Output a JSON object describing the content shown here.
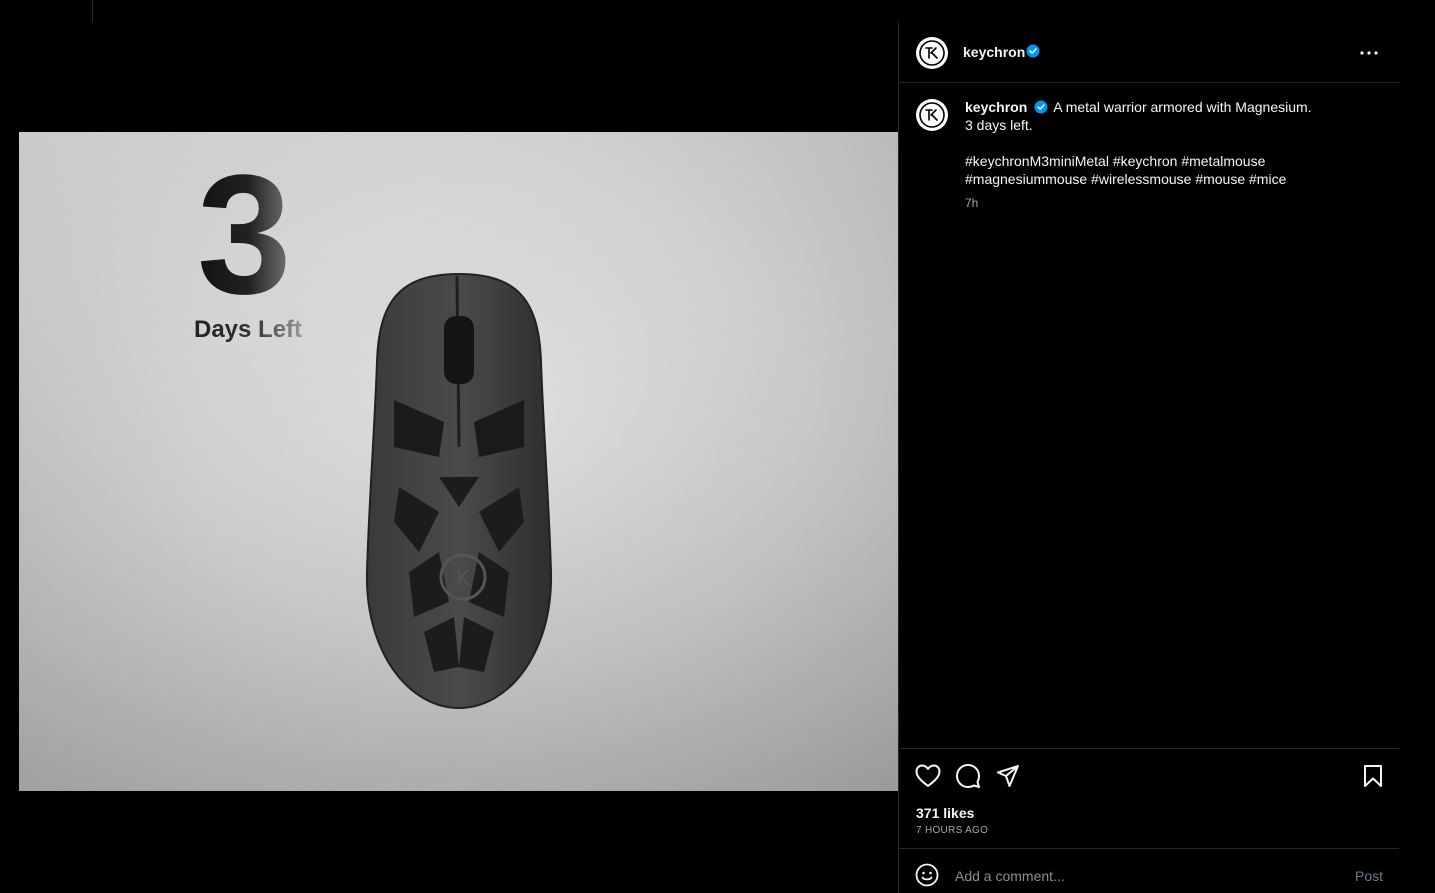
{
  "post": {
    "photo": {
      "number": "3",
      "tagline": "Days Left"
    },
    "header": {
      "username": "keychron",
      "verified_icon": "verified-badge-icon",
      "more_icon": "more-options-icon"
    },
    "caption": {
      "username": "keychron",
      "text": "A metal warrior armored with Magnesium.\n3 days left.\n\n#keychronM3miniMetal #keychron #metalmouse\n#magnesiummouse #wirelessmouse #mouse #mice",
      "time": "7h"
    },
    "actions": {
      "like_icon": "heart-icon",
      "comment_icon": "comment-icon",
      "share_icon": "send-icon",
      "save_icon": "bookmark-icon"
    },
    "likes": "371 likes",
    "posted": "7 HOURS AGO",
    "comment": {
      "placeholder": "Add a comment...",
      "value": "",
      "post_label": "Post"
    }
  },
  "colors": {
    "background": "#000000",
    "text": "#f5f5f5",
    "muted": "#a8a8a8",
    "border": "#262626",
    "verified": "#0095f6",
    "post_disabled": "#6b7d8f"
  }
}
